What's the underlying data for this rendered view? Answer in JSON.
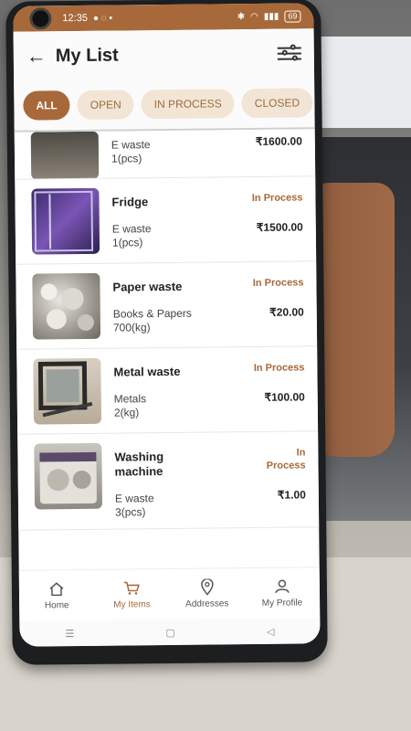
{
  "status_bar": {
    "time": "12:35",
    "battery": "69"
  },
  "header": {
    "title": "My List"
  },
  "tabs": [
    {
      "label": "ALL",
      "active": true
    },
    {
      "label": "OPEN",
      "active": false
    },
    {
      "label": "IN PROCESS",
      "active": false
    },
    {
      "label": "CLOSED",
      "active": false
    }
  ],
  "items": [
    {
      "name": "",
      "category": "E waste",
      "quantity": "1(pcs)",
      "status": "",
      "price": "₹1600.00",
      "partial": true
    },
    {
      "name": "Fridge",
      "category": "E waste",
      "quantity": "1(pcs)",
      "status": "In Process",
      "price": "₹1500.00"
    },
    {
      "name": "Paper waste",
      "category": "Books & Papers",
      "quantity": "700(kg)",
      "status": "In Process",
      "price": "₹20.00"
    },
    {
      "name": "Metal waste",
      "category": "Metals",
      "quantity": "2(kg)",
      "status": "In Process",
      "price": "₹100.00"
    },
    {
      "name": "Washing machine",
      "category": "E waste",
      "quantity": "3(pcs)",
      "status": "In Process",
      "price": "₹1.00"
    }
  ],
  "bottom_nav": [
    {
      "label": "Home",
      "icon": "home-icon",
      "active": false
    },
    {
      "label": "My Items",
      "icon": "cart-icon",
      "active": true
    },
    {
      "label": "Addresses",
      "icon": "location-pin-icon",
      "active": false
    },
    {
      "label": "My Profile",
      "icon": "person-icon",
      "active": false
    }
  ],
  "colors": {
    "accent": "#a8693a",
    "tab_inactive_bg": "#f2e5d6"
  }
}
